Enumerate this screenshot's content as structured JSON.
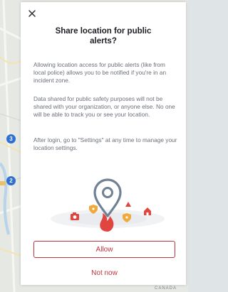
{
  "map": {
    "markers": [
      "3",
      "2"
    ],
    "attribution": "CANADA"
  },
  "dialog": {
    "title": "Share location for public alerts?",
    "paragraphs": [
      "Allowing location access for public alerts (like from local police) allows you to be notified if you're in an incident zone.",
      "Data shared for public safety purposes will not be shared with your organization, or anyone else. No one will be able to track you or see your location.",
      "After login, go to \"Settings\" at any time to manage your location settings."
    ],
    "allow_label": "Allow",
    "not_now_label": "Not now",
    "close_icon": "close-icon",
    "accent_color": "#c2333b"
  }
}
